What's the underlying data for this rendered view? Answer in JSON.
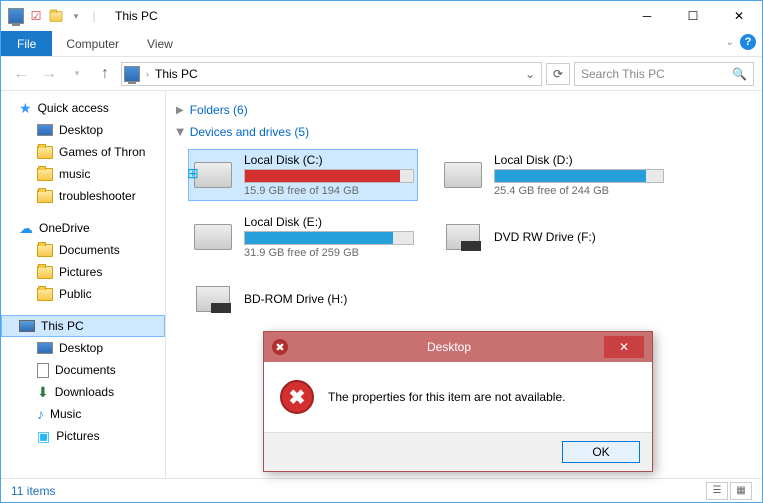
{
  "window": {
    "title": "This PC",
    "address": "This PC",
    "search_placeholder": "Search This PC"
  },
  "menu": {
    "file": "File",
    "computer": "Computer",
    "view": "View"
  },
  "sidebar": {
    "quick_access": "Quick access",
    "qa_items": [
      "Desktop",
      "Games of Thron",
      "music",
      "troubleshooter"
    ],
    "onedrive": "OneDrive",
    "od_items": [
      "Documents",
      "Pictures",
      "Public"
    ],
    "this_pc": "This PC",
    "pc_items": [
      "Desktop",
      "Documents",
      "Downloads",
      "Music",
      "Pictures"
    ]
  },
  "groups": {
    "folders": "Folders (6)",
    "devices": "Devices and drives (5)"
  },
  "drives": [
    {
      "name": "Local Disk (C:)",
      "free": "15.9 GB free of 194 GB",
      "pct": 92,
      "color": "red",
      "type": "hdd-win"
    },
    {
      "name": "Local Disk (D:)",
      "free": "25.4 GB free of 244 GB",
      "pct": 90,
      "color": "blue",
      "type": "hdd"
    },
    {
      "name": "Local Disk (E:)",
      "free": "31.9 GB free of 259 GB",
      "pct": 88,
      "color": "blue",
      "type": "hdd"
    },
    {
      "name": "DVD RW Drive (F:)",
      "free": "",
      "pct": 0,
      "color": "",
      "type": "dvd"
    },
    {
      "name": "BD-ROM Drive (H:)",
      "free": "",
      "pct": 0,
      "color": "",
      "type": "bd"
    }
  ],
  "status": {
    "items": "11 items"
  },
  "dialog": {
    "title": "Desktop",
    "message": "The properties for this item are not available.",
    "ok": "OK"
  }
}
